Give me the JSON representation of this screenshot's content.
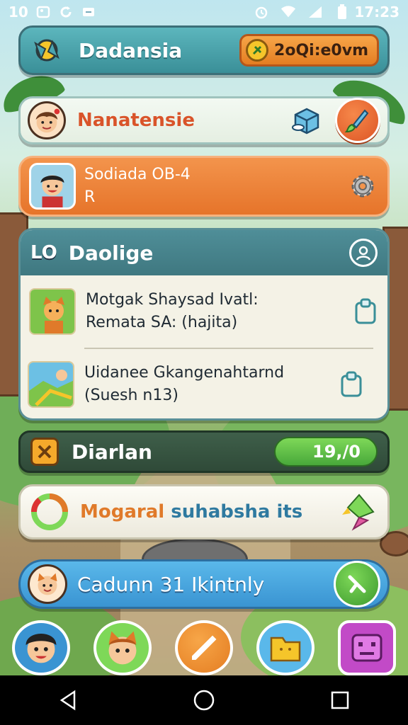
{
  "status_bar": {
    "left_text": "10",
    "time": "17:23",
    "icons": [
      "image-icon",
      "refresh-icon",
      "minus-icon",
      "alarm-icon",
      "wifi-icon",
      "signal-icon",
      "battery-icon"
    ]
  },
  "header": {
    "title": "Dadansia",
    "currency_value": "2oQi:e0vm",
    "logo_icon": "compass-icon"
  },
  "profile": {
    "name": "Nanatensie",
    "icons": [
      "avatar-icon",
      "crate-icon",
      "brush-icon"
    ]
  },
  "quest": {
    "line1": "Sodiada OB-4",
    "line2": "R",
    "icon": "gear-icon"
  },
  "panel": {
    "badge": "LO",
    "title": "Daolige",
    "rows": [
      {
        "line1": "Motgak Shaysad Ivatl:",
        "line2": "Remata SA: (hajita)"
      },
      {
        "line1": "Uidanee Gkangenahtarnd",
        "line2": "(Suesh n13)"
      }
    ]
  },
  "currency": {
    "label": "Diarlan",
    "value": "19,/0"
  },
  "banner": {
    "text_a": "Mogaral",
    "text_b": "suhabsha its"
  },
  "cta": {
    "label": "Cadunn 31 Ikintnly"
  },
  "dock": {
    "items": [
      "boy-avatar-icon",
      "cat-avatar-icon",
      "note-icon",
      "folder-icon",
      "robot-icon"
    ]
  },
  "colors": {
    "accent_teal": "#3a8f98",
    "accent_orange": "#e6742a",
    "accent_blue": "#3a94d2",
    "accent_green": "#48a83a"
  }
}
